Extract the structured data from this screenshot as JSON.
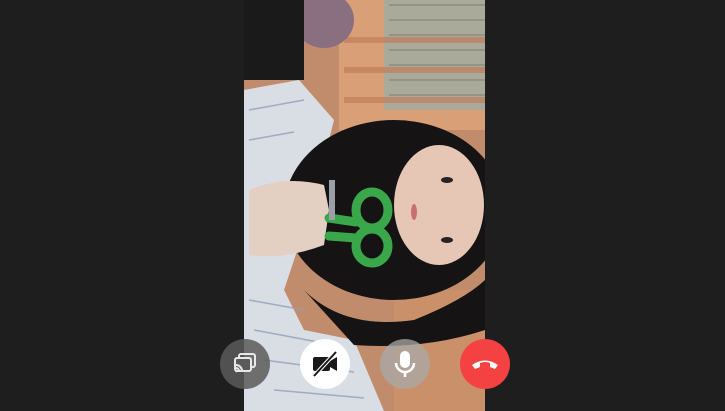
{
  "call": {
    "video_feed": "remote-participant-video"
  },
  "controls": [
    {
      "id": "cast",
      "icon": "cast-icon",
      "state": "off"
    },
    {
      "id": "camera",
      "icon": "video-camera-off-icon",
      "state": "camera-off"
    },
    {
      "id": "mic",
      "icon": "microphone-icon",
      "state": "on"
    },
    {
      "id": "end",
      "icon": "phone-hangup-icon",
      "state": "active"
    }
  ],
  "colors": {
    "background": "#1e1e1e",
    "end_call": "#f44141",
    "camera_button": "#ffffff",
    "mic_button": "#b0b0b0",
    "cast_button": "#5a5a5a"
  }
}
